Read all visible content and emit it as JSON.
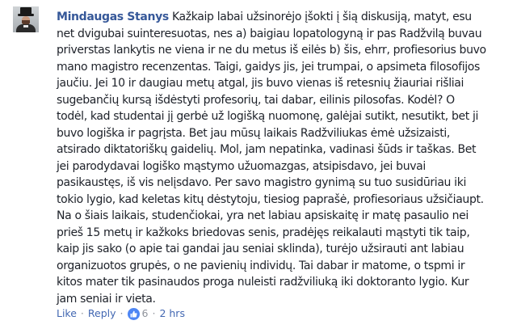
{
  "comment": {
    "author": "Mindaugas Stanys",
    "text": " Kažkaip labai užsinorėjo įšokti į šią diskusiją, matyt, esu\nnet dvigubai suinteresuotas, nes a) baigiau lopatologyną ir pas Radžvilą buvau\npriverstas lankytis ne viena ir ne du metus iš eilės b) šis, ehrr, profiesorius buvo\nmano magistro recenzentas. Taigi, gaidys jis, jei trumpai, o apsimeta filosofijos\njaučiu. Jei 10 ir daugiau metų atgal, jis buvo vienas iš retesnių žiauriai rišliai\nsugebančių kursą išdėstyti profesorių, tai dabar, eilinis pilosofas. Kodėl? O\ntodėl, kad studentai jį gerbė už logišką nuomonę, galėjai sutikt, nesutikt, bet ji\nbuvo logiška ir pagrįsta. Bet jau mūsų laikais Radžviliukas ėmė užsizaisti,\natsirado diktatoriškų gaidelių. Mol, jam nepatinka, vadinasi šūds ir taškas. Bet\njei parodydavai logiško mąstymo užuomazgas, atsipisdavo, jei buvai\npasikaustęs, iš vis nelįsdavo. Per savo magistro gynimą su tuo susidūriau iki\ntokio lygio, kad keletas kitų dėstytoju, tiesiog paprašė, profiesoriaus užsičiaupt.\nNa o šiais laikais, studenčiokai, yra net labiau apsiskaitę ir matę pasaulio nei\nprieš 15 metų ir kažkoks briedovas senis, pradėjęs reikalauti mąstyti tik taip,\nkaip jis sako (o apie tai gandai jau seniai sklinda), turėjo užsirauti ant labiau\norganizuotos grupės, o ne pavienių individų. Tai dabar ir matome, o tspmi ir\nkitos mater tik pasinaudos proga nuleisti radžviliuką iki doktoranto lygio. Kur\njam seniai ir vieta."
  },
  "actions": {
    "like_label": "Like",
    "separator": "·",
    "reply_label": "Reply",
    "reaction_count": "6",
    "timestamp": "2 hrs"
  },
  "colors": {
    "author": "#365899",
    "link": "#4267b2",
    "meta": "#90949c",
    "like_badge": "#4e86f4",
    "text": "#1d2129"
  },
  "icons": {
    "reaction": "like-thumb-icon"
  }
}
